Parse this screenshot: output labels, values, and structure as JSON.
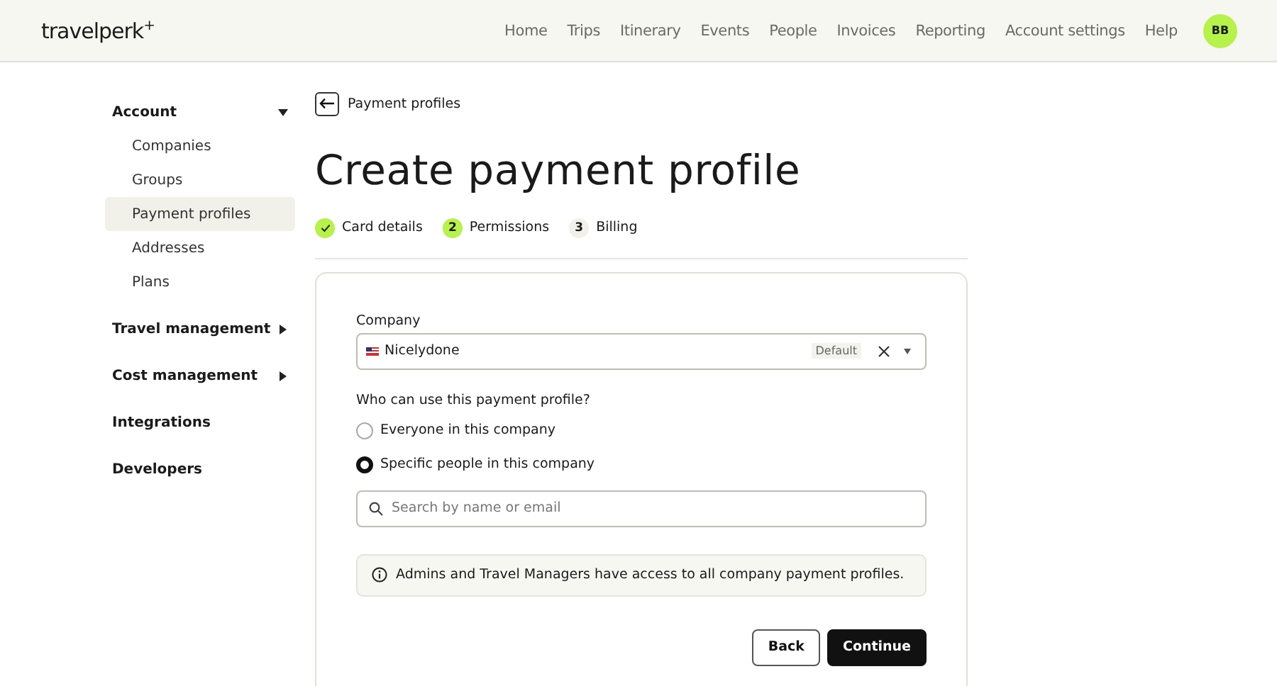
{
  "header": {
    "logo": "travelperk$^{+}$",
    "nav": [
      {
        "label": "Home"
      },
      {
        "label": "Trips"
      },
      {
        "label": "Itinerary"
      },
      {
        "label": "Events"
      },
      {
        "label": "People"
      },
      {
        "label": "Invoices"
      },
      {
        "label": "Reporting"
      },
      {
        "label": "Account settings"
      },
      {
        "label": "Help"
      }
    ],
    "avatar": "BB"
  },
  "sidebar": {
    "items": [
      {
        "label": "Account",
        "expanded": true,
        "children": [
          {
            "label": "Companies",
            "selected": false
          },
          {
            "label": "Groups",
            "selected": false
          },
          {
            "label": "Payment profiles",
            "selected": true
          },
          {
            "label": "Addresses",
            "selected": false
          },
          {
            "label": "Plans",
            "selected": false
          }
        ]
      },
      {
        "label": "Travel management",
        "expanded": false
      },
      {
        "label": "Cost management",
        "expanded": false
      },
      {
        "label": "Integrations"
      },
      {
        "label": "Developers"
      }
    ]
  },
  "breadcrumb": "Payment profiles",
  "title": "Create payment profile",
  "steps": [
    {
      "label": "Card details",
      "completed": true,
      "selected": false
    },
    {
      "number": "2",
      "label": "Permissions",
      "completed": false,
      "selected": true
    },
    {
      "number": "3",
      "label": "Billing",
      "completed": false,
      "selected": false
    }
  ],
  "form": {
    "company_label": "Company",
    "company_value": "Nicelydone",
    "company_badge": "Default",
    "question": "Who can use this payment profile?",
    "options": [
      {
        "label": "Everyone in this company",
        "selected": false
      },
      {
        "label": "Specific people in this company",
        "selected": true
      }
    ],
    "search": {
      "placeholder": "Search by name or email"
    },
    "notice": "Admins and Travel Managers have access to all company payment profiles.",
    "buttons": [
      {
        "label": "Back",
        "kind": "secondary"
      },
      {
        "label": "Continue",
        "kind": "primary"
      }
    ]
  }
}
